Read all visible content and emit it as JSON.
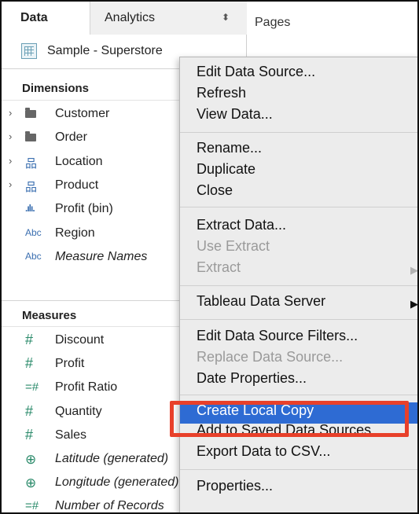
{
  "tabs": {
    "data": "Data",
    "analytics": "Analytics",
    "analytics_icon": "up-down-arrows-icon"
  },
  "source": {
    "name": "Sample - Superstore",
    "icon": "database-icon"
  },
  "dimensions": {
    "title": "Dimensions",
    "items": [
      {
        "label": "Customer",
        "icon": "folder-icon",
        "expandable": true,
        "italic": false
      },
      {
        "label": "Order",
        "icon": "folder-icon",
        "expandable": true,
        "italic": false
      },
      {
        "label": "Location",
        "icon": "hierarchy-icon",
        "expandable": true,
        "italic": false
      },
      {
        "label": "Product",
        "icon": "hierarchy-icon",
        "expandable": true,
        "italic": false
      },
      {
        "label": "Profit (bin)",
        "icon": "bin-icon",
        "icon_text": ".ılı.",
        "expandable": false,
        "italic": false
      },
      {
        "label": "Region",
        "icon": "abc-icon",
        "icon_text": "Abc",
        "expandable": false,
        "italic": false
      },
      {
        "label": "Measure Names",
        "icon": "abc-icon",
        "icon_text": "Abc",
        "expandable": false,
        "italic": true
      }
    ]
  },
  "measures": {
    "title": "Measures",
    "items": [
      {
        "label": "Discount",
        "icon": "hash-icon",
        "icon_text": "#",
        "italic": false
      },
      {
        "label": "Profit",
        "icon": "hash-icon",
        "icon_text": "#",
        "italic": false
      },
      {
        "label": "Profit Ratio",
        "icon": "calculated-hash-icon",
        "icon_text": "=#",
        "italic": false
      },
      {
        "label": "Quantity",
        "icon": "hash-icon",
        "icon_text": "#",
        "italic": false
      },
      {
        "label": "Sales",
        "icon": "hash-icon",
        "icon_text": "#",
        "italic": false
      },
      {
        "label": "Latitude (generated)",
        "icon": "globe-icon",
        "icon_text": "⊕",
        "italic": true
      },
      {
        "label": "Longitude (generated)",
        "icon": "globe-icon",
        "icon_text": "⊕",
        "italic": true
      },
      {
        "label": "Number of Records",
        "icon": "calculated-hash-icon",
        "icon_text": "=#",
        "italic": true
      }
    ]
  },
  "shelves": {
    "pages": "Pages"
  },
  "context_menu": {
    "items": [
      {
        "label": "Edit Data Source...",
        "disabled": false
      },
      {
        "label": "Refresh",
        "disabled": false
      },
      {
        "label": "View Data...",
        "disabled": false
      },
      {
        "label": "Rename...",
        "disabled": false
      },
      {
        "label": "Duplicate",
        "disabled": false
      },
      {
        "label": "Close",
        "disabled": false
      },
      {
        "label": "Extract Data...",
        "disabled": false
      },
      {
        "label": "Use Extract",
        "disabled": true
      },
      {
        "label": "Extract",
        "disabled": true,
        "submenu": true
      },
      {
        "label": "Tableau Data Server",
        "disabled": false,
        "submenu": true
      },
      {
        "label": "Edit Data Source Filters...",
        "disabled": false
      },
      {
        "label": "Replace Data Source...",
        "disabled": true
      },
      {
        "label": "Date Properties...",
        "disabled": false
      },
      {
        "label": "Create Local Copy",
        "disabled": false,
        "highlighted": true
      },
      {
        "label": "Add to Saved Data Sources...",
        "disabled": false
      },
      {
        "label": "Export Data to CSV...",
        "disabled": false
      },
      {
        "label": "Properties...",
        "disabled": false
      }
    ]
  },
  "colors": {
    "highlight": "#2e6bd3",
    "callout": "#e8402a",
    "menu_bg": "#ececec"
  }
}
